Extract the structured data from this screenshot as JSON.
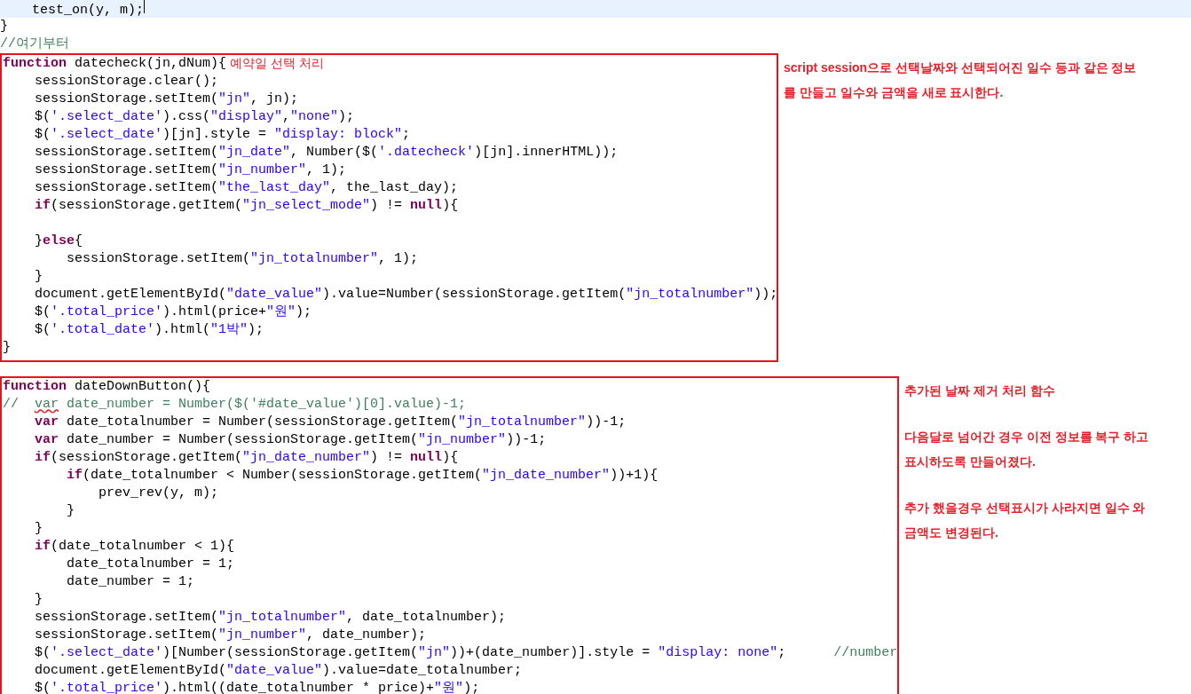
{
  "preamble": [
    {
      "current": true,
      "tokens": [
        {
          "kind": "plain",
          "text": "    test_on(y, m);"
        }
      ]
    },
    {
      "current": false,
      "tokens": [
        {
          "kind": "plain",
          "text": "}"
        }
      ]
    },
    {
      "current": false,
      "tokens": [
        {
          "kind": "comment",
          "text": "//여기부터"
        }
      ]
    }
  ],
  "blocks": [
    {
      "lines": [
        {
          "kind": "code",
          "tokens": [
            {
              "kind": "keyword",
              "text": "function"
            },
            {
              "kind": "plain",
              "text": " datecheck(jn,dNum){"
            }
          ],
          "note": "예약일 선택 처리"
        },
        {
          "kind": "code",
          "tokens": [
            {
              "kind": "plain",
              "text": "    sessionStorage.clear();"
            }
          ]
        },
        {
          "kind": "code",
          "tokens": [
            {
              "kind": "plain",
              "text": "    sessionStorage.setItem("
            },
            {
              "kind": "string",
              "text": "\"jn\""
            },
            {
              "kind": "plain",
              "text": ", jn);"
            }
          ]
        },
        {
          "kind": "code",
          "tokens": [
            {
              "kind": "plain",
              "text": "    $("
            },
            {
              "kind": "string",
              "text": "'.select_date'"
            },
            {
              "kind": "plain",
              "text": ").css("
            },
            {
              "kind": "string",
              "text": "\"display\""
            },
            {
              "kind": "plain",
              "text": ","
            },
            {
              "kind": "string",
              "text": "\"none\""
            },
            {
              "kind": "plain",
              "text": ");"
            }
          ]
        },
        {
          "kind": "code",
          "tokens": [
            {
              "kind": "plain",
              "text": "    $("
            },
            {
              "kind": "string",
              "text": "'.select_date'"
            },
            {
              "kind": "plain",
              "text": ")[jn].style = "
            },
            {
              "kind": "string",
              "text": "\"display: block\""
            },
            {
              "kind": "plain",
              "text": ";"
            }
          ]
        },
        {
          "kind": "code",
          "tokens": [
            {
              "kind": "plain",
              "text": "    sessionStorage.setItem("
            },
            {
              "kind": "string",
              "text": "\"jn_date\""
            },
            {
              "kind": "plain",
              "text": ", Number($("
            },
            {
              "kind": "string",
              "text": "'.datecheck'"
            },
            {
              "kind": "plain",
              "text": ")[jn].innerHTML));"
            }
          ]
        },
        {
          "kind": "code",
          "tokens": [
            {
              "kind": "plain",
              "text": "    sessionStorage.setItem("
            },
            {
              "kind": "string",
              "text": "\"jn_number\""
            },
            {
              "kind": "plain",
              "text": ", 1);"
            }
          ]
        },
        {
          "kind": "code",
          "tokens": [
            {
              "kind": "plain",
              "text": "    sessionStorage.setItem("
            },
            {
              "kind": "string",
              "text": "\"the_last_day\""
            },
            {
              "kind": "plain",
              "text": ", the_last_day);"
            }
          ]
        },
        {
          "kind": "code",
          "tokens": [
            {
              "kind": "keyword",
              "text": "    if"
            },
            {
              "kind": "plain",
              "text": "(sessionStorage.getItem("
            },
            {
              "kind": "string",
              "text": "\"jn_select_mode\""
            },
            {
              "kind": "plain",
              "text": ") != "
            },
            {
              "kind": "keyword",
              "text": "null"
            },
            {
              "kind": "plain",
              "text": "){"
            }
          ]
        },
        {
          "kind": "blank"
        },
        {
          "kind": "code",
          "tokens": [
            {
              "kind": "plain",
              "text": "    }"
            },
            {
              "kind": "keyword",
              "text": "else"
            },
            {
              "kind": "plain",
              "text": "{"
            }
          ]
        },
        {
          "kind": "code",
          "tokens": [
            {
              "kind": "plain",
              "text": "        sessionStorage.setItem("
            },
            {
              "kind": "string",
              "text": "\"jn_totalnumber\""
            },
            {
              "kind": "plain",
              "text": ", 1);"
            }
          ]
        },
        {
          "kind": "code",
          "tokens": [
            {
              "kind": "plain",
              "text": "    }"
            }
          ]
        },
        {
          "kind": "code",
          "tokens": [
            {
              "kind": "plain",
              "text": "    document.getElementById("
            },
            {
              "kind": "string",
              "text": "\"date_value\""
            },
            {
              "kind": "plain",
              "text": ").value=Number(sessionStorage.getItem("
            },
            {
              "kind": "string",
              "text": "\"jn_totalnumber\""
            },
            {
              "kind": "plain",
              "text": "));"
            }
          ]
        },
        {
          "kind": "code",
          "tokens": [
            {
              "kind": "plain",
              "text": "    $("
            },
            {
              "kind": "string",
              "text": "'.total_price'"
            },
            {
              "kind": "plain",
              "text": ").html(price+"
            },
            {
              "kind": "string",
              "text": "\"원\""
            },
            {
              "kind": "plain",
              "text": ");"
            }
          ]
        },
        {
          "kind": "code",
          "tokens": [
            {
              "kind": "plain",
              "text": "    $("
            },
            {
              "kind": "string",
              "text": "'.total_date'"
            },
            {
              "kind": "plain",
              "text": ").html("
            },
            {
              "kind": "string",
              "text": "\"1박\""
            },
            {
              "kind": "plain",
              "text": ");"
            }
          ]
        },
        {
          "kind": "code",
          "tokens": [
            {
              "kind": "plain",
              "text": "}"
            }
          ]
        }
      ],
      "notes": [
        [
          "script session으로 선택날짜와 선택되어진 일수 등과 같은 정보",
          "를 만들고 일수와 금액을 새로 표시한다."
        ]
      ]
    },
    {
      "lines": [
        {
          "kind": "code",
          "tokens": [
            {
              "kind": "keyword",
              "text": "function"
            },
            {
              "kind": "plain",
              "text": " dateDownButton(){"
            }
          ]
        },
        {
          "kind": "code",
          "tokens": [
            {
              "kind": "comment",
              "text": "//  "
            },
            {
              "kind": "flagged-comment",
              "text": "var"
            },
            {
              "kind": "comment",
              "text": " date_number = Number($('#date_value')[0].value)-1;"
            }
          ]
        },
        {
          "kind": "code",
          "tokens": [
            {
              "kind": "keyword",
              "text": "    var"
            },
            {
              "kind": "plain",
              "text": " date_totalnumber = Number(sessionStorage.getItem("
            },
            {
              "kind": "string",
              "text": "\"jn_totalnumber\""
            },
            {
              "kind": "plain",
              "text": "))-1;"
            }
          ]
        },
        {
          "kind": "code",
          "tokens": [
            {
              "kind": "keyword",
              "text": "    var"
            },
            {
              "kind": "plain",
              "text": " date_number = Number(sessionStorage.getItem("
            },
            {
              "kind": "string",
              "text": "\"jn_number\""
            },
            {
              "kind": "plain",
              "text": "))-1;"
            }
          ]
        },
        {
          "kind": "code",
          "tokens": [
            {
              "kind": "keyword",
              "text": "    if"
            },
            {
              "kind": "plain",
              "text": "(sessionStorage.getItem("
            },
            {
              "kind": "string",
              "text": "\"jn_date_number\""
            },
            {
              "kind": "plain",
              "text": ") != "
            },
            {
              "kind": "keyword",
              "text": "null"
            },
            {
              "kind": "plain",
              "text": "){"
            }
          ]
        },
        {
          "kind": "code",
          "tokens": [
            {
              "kind": "keyword",
              "text": "        if"
            },
            {
              "kind": "plain",
              "text": "(date_totalnumber < Number(sessionStorage.getItem("
            },
            {
              "kind": "string",
              "text": "\"jn_date_number\""
            },
            {
              "kind": "plain",
              "text": "))+1){"
            }
          ]
        },
        {
          "kind": "code",
          "tokens": [
            {
              "kind": "plain",
              "text": "            prev_rev(y, m);"
            }
          ]
        },
        {
          "kind": "code",
          "tokens": [
            {
              "kind": "plain",
              "text": "        }"
            }
          ]
        },
        {
          "kind": "code",
          "tokens": [
            {
              "kind": "plain",
              "text": "    }"
            }
          ]
        },
        {
          "kind": "code",
          "tokens": [
            {
              "kind": "keyword",
              "text": "    if"
            },
            {
              "kind": "plain",
              "text": "(date_totalnumber < 1){"
            }
          ]
        },
        {
          "kind": "code",
          "tokens": [
            {
              "kind": "plain",
              "text": "        date_totalnumber = 1;"
            }
          ]
        },
        {
          "kind": "code",
          "tokens": [
            {
              "kind": "plain",
              "text": "        date_number = 1;"
            }
          ]
        },
        {
          "kind": "code",
          "tokens": [
            {
              "kind": "plain",
              "text": "    }"
            }
          ]
        },
        {
          "kind": "code",
          "tokens": [
            {
              "kind": "plain",
              "text": "    sessionStorage.setItem("
            },
            {
              "kind": "string",
              "text": "\"jn_totalnumber\""
            },
            {
              "kind": "plain",
              "text": ", date_totalnumber);"
            }
          ]
        },
        {
          "kind": "code",
          "tokens": [
            {
              "kind": "plain",
              "text": "    sessionStorage.setItem("
            },
            {
              "kind": "string",
              "text": "\"jn_number\""
            },
            {
              "kind": "plain",
              "text": ", date_number);"
            }
          ]
        },
        {
          "kind": "code",
          "tokens": [
            {
              "kind": "plain",
              "text": "    $("
            },
            {
              "kind": "string",
              "text": "'.select_date'"
            },
            {
              "kind": "plain",
              "text": ")[Number(sessionStorage.getItem("
            },
            {
              "kind": "string",
              "text": "\"jn\""
            },
            {
              "kind": "plain",
              "text": "))+(date_number)].style = "
            },
            {
              "kind": "string",
              "text": "\"display: none\""
            },
            {
              "kind": "plain",
              "text": ";      "
            },
            {
              "kind": "comment",
              "text": "//number"
            }
          ]
        },
        {
          "kind": "code",
          "tokens": [
            {
              "kind": "plain",
              "text": "    document.getElementById("
            },
            {
              "kind": "string",
              "text": "\"date_value\""
            },
            {
              "kind": "plain",
              "text": ").value=date_totalnumber;"
            }
          ]
        },
        {
          "kind": "code",
          "tokens": [
            {
              "kind": "plain",
              "text": "    $("
            },
            {
              "kind": "string",
              "text": "'.total_price'"
            },
            {
              "kind": "plain",
              "text": ").html((date_totalnumber * price)+"
            },
            {
              "kind": "string",
              "text": "\"원\""
            },
            {
              "kind": "plain",
              "text": ");"
            }
          ]
        }
      ],
      "notes": [
        [
          "추가된 날짜 제거 처리 함수"
        ],
        [
          "다음달로 넘어간 경우 이전 정보를 복구 하고",
          "표시하도록 만들어졌다."
        ],
        [
          "추가 했을경우 선택표시가 사라지면 일수 와",
          "금액도 변경된다."
        ]
      ]
    }
  ]
}
